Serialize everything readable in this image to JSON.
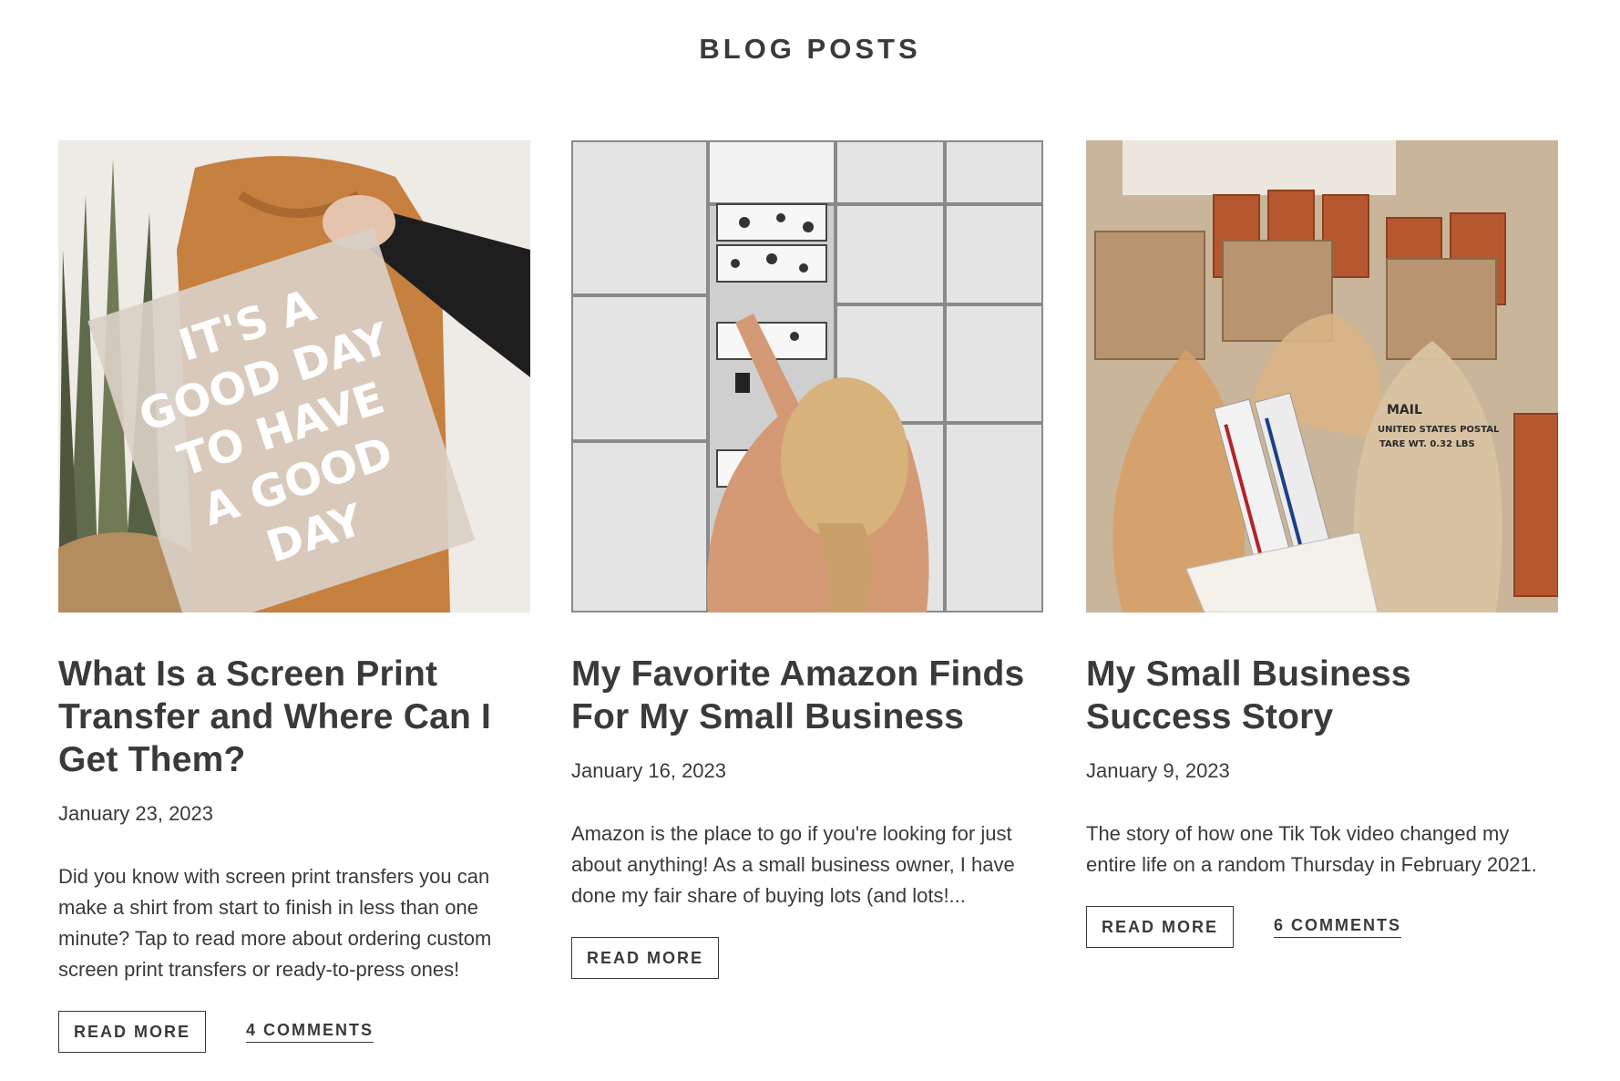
{
  "header": {
    "title": "BLOG POSTS"
  },
  "posts": [
    {
      "title": "What Is a Screen Print Transfer and Where Can I Get Them?",
      "date": "January 23, 2023",
      "excerpt": "Did you know with screen print transfers you can make a shirt from start to finish in less than one minute? Tap to read more about ordering custom screen print transfers or ready-to-press ones!",
      "read_more_label": "READ MORE",
      "comments_label": "4 COMMENTS",
      "image": {
        "line1": "IT'S A",
        "line2": "GOOD DAY",
        "line3": "TO HAVE",
        "line4": "A GOOD",
        "line5": "DAY"
      }
    },
    {
      "title": "My Favorite Amazon Finds For My Small Business",
      "date": "January 16, 2023",
      "excerpt": "Amazon is the place to go if you're looking for just about anything! As a small business owner, I have done my fair share of buying lots (and lots!...",
      "read_more_label": "READ MORE"
    },
    {
      "title": "My Small Business Success Story",
      "date": "January 9, 2023",
      "excerpt": "The story of how one Tik Tok video changed my entire life on a random Thursday in February 2021.",
      "read_more_label": "READ MORE",
      "comments_label": "6 COMMENTS",
      "image": {
        "bag_label_1": "MAIL",
        "bag_label_2": "UNITED STATES POSTAL",
        "bag_label_3": "TARE WT. 0.32 LBS"
      }
    }
  ]
}
